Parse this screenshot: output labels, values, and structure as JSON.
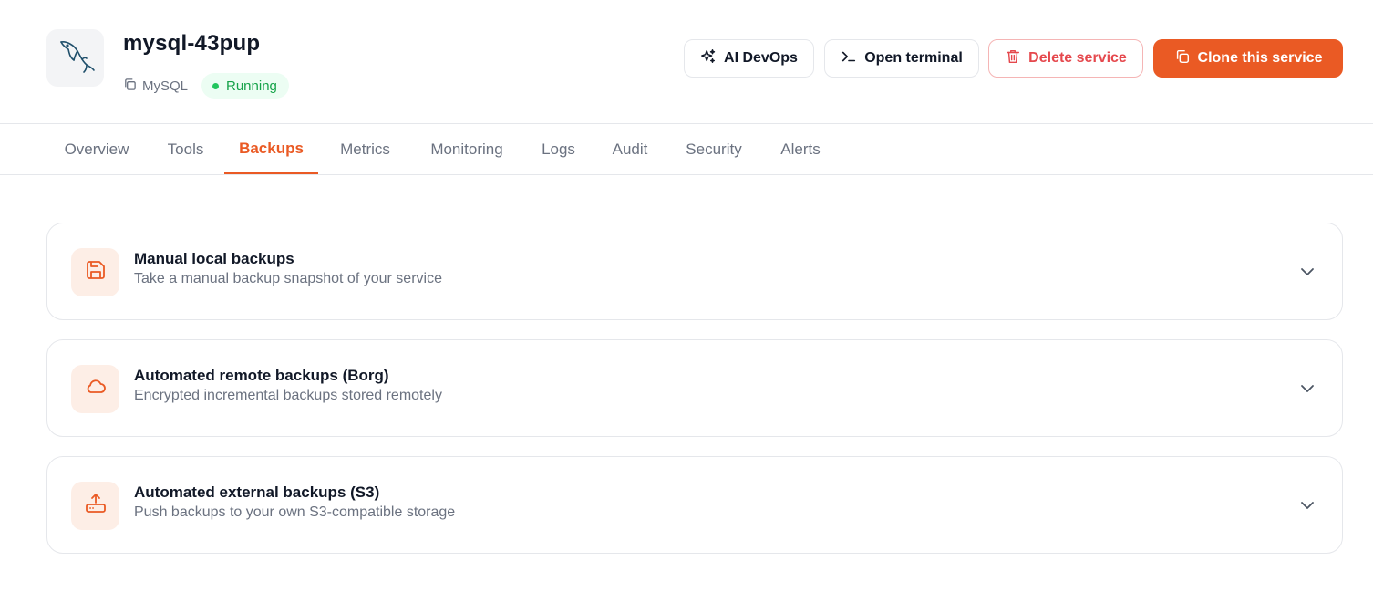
{
  "service": {
    "name": "mysql-43pup",
    "type": "MySQL",
    "status": "Running",
    "logo_icon": "mysql-dolphin-icon"
  },
  "actions": {
    "ai_devops": "AI DevOps",
    "open_terminal": "Open terminal",
    "delete_service": "Delete service",
    "clone_service": "Clone this service"
  },
  "tabs": [
    {
      "label": "Overview"
    },
    {
      "label": "Tools"
    },
    {
      "label": "Backups",
      "active": true
    },
    {
      "label": "Metrics"
    },
    {
      "label": "Monitoring"
    },
    {
      "label": "Logs"
    },
    {
      "label": "Audit"
    },
    {
      "label": "Security"
    },
    {
      "label": "Alerts"
    }
  ],
  "backups": [
    {
      "title": "Manual local backups",
      "description": "Take a manual backup snapshot of your service",
      "icon": "floppy-disk-icon"
    },
    {
      "title": "Automated remote backups (Borg)",
      "description": "Encrypted incremental backups stored remotely",
      "icon": "cloud-icon"
    },
    {
      "title": "Automated external backups (S3)",
      "description": "Push backups to your own S3-compatible storage",
      "icon": "upload-storage-icon"
    }
  ],
  "colors": {
    "accent": "#ea5a24",
    "danger": "#e5484d",
    "success": "#16a34a",
    "icon_bg": "#fdeee6"
  }
}
